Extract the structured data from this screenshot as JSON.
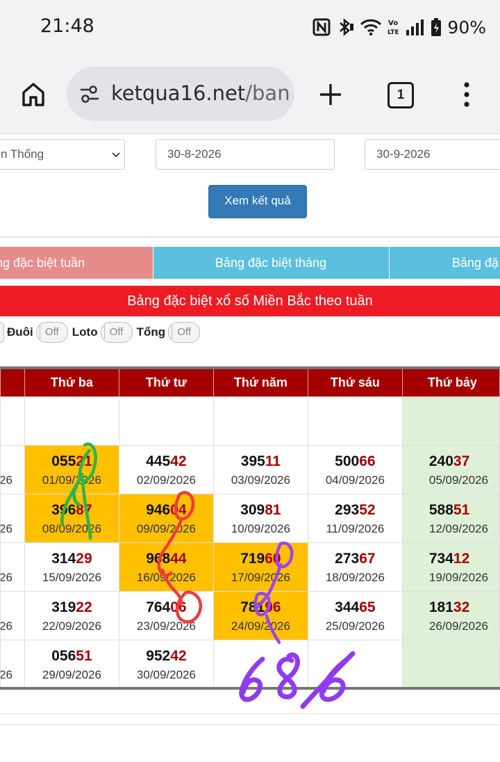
{
  "status_bar": {
    "time": "21:48",
    "battery": "90%"
  },
  "browser": {
    "url_main": "ketqua16.net",
    "url_path": "/ban",
    "tab_count": "1"
  },
  "form": {
    "region": "n Thống",
    "date_from": "30-8-2026",
    "date_to": "30-9-2026",
    "submit_label": "Xem kết quả"
  },
  "tabs": [
    {
      "label": "ng đặc biệt tuần"
    },
    {
      "label": "Bảng đặc biệt tháng"
    },
    {
      "label": "Bảng đặ"
    }
  ],
  "banner": "Bảng đặc biệt xổ số Miền Bắc theo tuần",
  "toggles": [
    {
      "label": "Đuôi",
      "state": "Off"
    },
    {
      "label": "Loto",
      "state": "Off"
    },
    {
      "label": "Tổng",
      "state": "Off"
    }
  ],
  "table": {
    "headers": [
      "Thứ ba",
      "Thứ tư",
      "Thứ năm",
      "Thứ sáu",
      "Thứ bảy"
    ],
    "rows": [
      {
        "left_date": "26",
        "cells": [
          {
            "head": "055",
            "tail": "21",
            "date": "01/09/2026",
            "hl": true
          },
          {
            "head": "445",
            "tail": "42",
            "date": "02/09/2026"
          },
          {
            "head": "395",
            "tail": "11",
            "date": "03/09/2026"
          },
          {
            "head": "500",
            "tail": "66",
            "date": "04/09/2026"
          },
          {
            "head": "240",
            "tail": "37",
            "date": "05/09/2026"
          }
        ]
      },
      {
        "left_date": "26",
        "cells": [
          {
            "head": "396",
            "tail": "87",
            "date": "08/09/2026",
            "hl": true
          },
          {
            "head": "946",
            "tail": "04",
            "date": "09/09/2026",
            "hl": true
          },
          {
            "head": "309",
            "tail": "81",
            "date": "10/09/2026"
          },
          {
            "head": "293",
            "tail": "52",
            "date": "11/09/2026"
          },
          {
            "head": "588",
            "tail": "51",
            "date": "12/09/2026"
          }
        ]
      },
      {
        "left_date": "26",
        "cells": [
          {
            "head": "314",
            "tail": "29",
            "date": "15/09/2026"
          },
          {
            "head": "968",
            "tail": "44",
            "date": "16/09/2026",
            "hl": true
          },
          {
            "head": "719",
            "tail": "60",
            "date": "17/09/2026",
            "hl": true
          },
          {
            "head": "273",
            "tail": "67",
            "date": "18/09/2026"
          },
          {
            "head": "734",
            "tail": "12",
            "date": "19/09/2026"
          }
        ]
      },
      {
        "left_date": "26",
        "cells": [
          {
            "head": "319",
            "tail": "22",
            "date": "22/09/2026"
          },
          {
            "head": "764",
            "tail": "06",
            "date": "23/09/2026"
          },
          {
            "head": "781",
            "tail": "96",
            "date": "24/09/2026",
            "hl": true
          },
          {
            "head": "344",
            "tail": "65",
            "date": "25/09/2026"
          },
          {
            "head": "181",
            "tail": "32",
            "date": "26/09/2026"
          }
        ]
      },
      {
        "left_date": "26",
        "cells": [
          {
            "head": "056",
            "tail": "51",
            "date": "29/09/2026"
          },
          {
            "head": "952",
            "tail": "42",
            "date": "30/09/2026"
          },
          {
            "head": "",
            "tail": "",
            "date": ""
          },
          {
            "head": "",
            "tail": "",
            "date": ""
          },
          {
            "head": "",
            "tail": "",
            "date": ""
          }
        ]
      }
    ]
  },
  "annotation": "686"
}
